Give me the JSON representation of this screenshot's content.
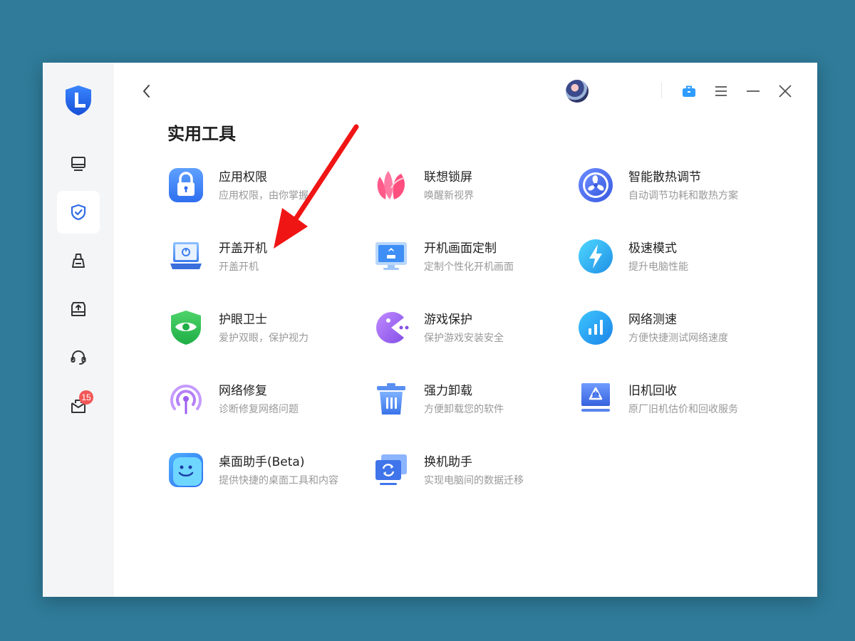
{
  "sidebar": {
    "logo_icon": "shield-l-logo",
    "items": [
      {
        "name": "sidebar-item-device",
        "icon": "monitor-icon"
      },
      {
        "name": "sidebar-item-security",
        "icon": "shield-check-icon",
        "active": true
      },
      {
        "name": "sidebar-item-cleanup",
        "icon": "broom-icon"
      },
      {
        "name": "sidebar-item-drive",
        "icon": "drive-upload-icon"
      },
      {
        "name": "sidebar-item-support",
        "icon": "headset-icon"
      },
      {
        "name": "sidebar-item-messages",
        "icon": "mailbox-icon",
        "badge": "15"
      }
    ]
  },
  "header": {
    "back_icon": "chevron-left-icon",
    "avatar": "user-avatar",
    "icons": [
      "briefcase-icon",
      "menu-icon",
      "minimize-icon",
      "close-icon"
    ]
  },
  "page": {
    "title": "实用工具"
  },
  "tools": [
    {
      "name": "应用权限",
      "desc": "应用权限，由你掌握",
      "icon": "lock-icon"
    },
    {
      "name": "联想锁屏",
      "desc": "唤醒新视界",
      "icon": "petal-icon"
    },
    {
      "name": "智能散热调节",
      "desc": "自动调节功耗和散热方案",
      "icon": "fan-icon"
    },
    {
      "name": "开盖开机",
      "desc": "开盖开机",
      "icon": "laptop-power-icon"
    },
    {
      "name": "开机画面定制",
      "desc": "定制个性化开机画面",
      "icon": "monitor-flower-icon"
    },
    {
      "name": "极速模式",
      "desc": "提升电脑性能",
      "icon": "lightning-icon"
    },
    {
      "name": "护眼卫士",
      "desc": "爱护双眼，保护视力",
      "icon": "eye-shield-icon"
    },
    {
      "name": "游戏保护",
      "desc": "保护游戏安装安全",
      "icon": "pacman-icon"
    },
    {
      "name": "网络测速",
      "desc": "方便快捷测试网络速度",
      "icon": "bar-chart-icon"
    },
    {
      "name": "网络修复",
      "desc": "诊断修复网络问题",
      "icon": "signal-icon"
    },
    {
      "name": "强力卸载",
      "desc": "方便卸载您的软件",
      "icon": "trash-icon"
    },
    {
      "name": "旧机回收",
      "desc": "原厂旧机估价和回收服务",
      "icon": "recycle-monitor-icon"
    },
    {
      "name": "桌面助手(Beta)",
      "desc": "提供快捷的桌面工具和内容",
      "icon": "smile-icon"
    },
    {
      "name": "换机助手",
      "desc": "实现电脑间的数据迁移",
      "icon": "transfer-icon"
    }
  ],
  "colors": {
    "background": "#2f7b99",
    "sidebar": "#f4f5f7",
    "accent": "#2e6be6",
    "badge": "#f25757",
    "annotation_arrow": "#f01515"
  }
}
